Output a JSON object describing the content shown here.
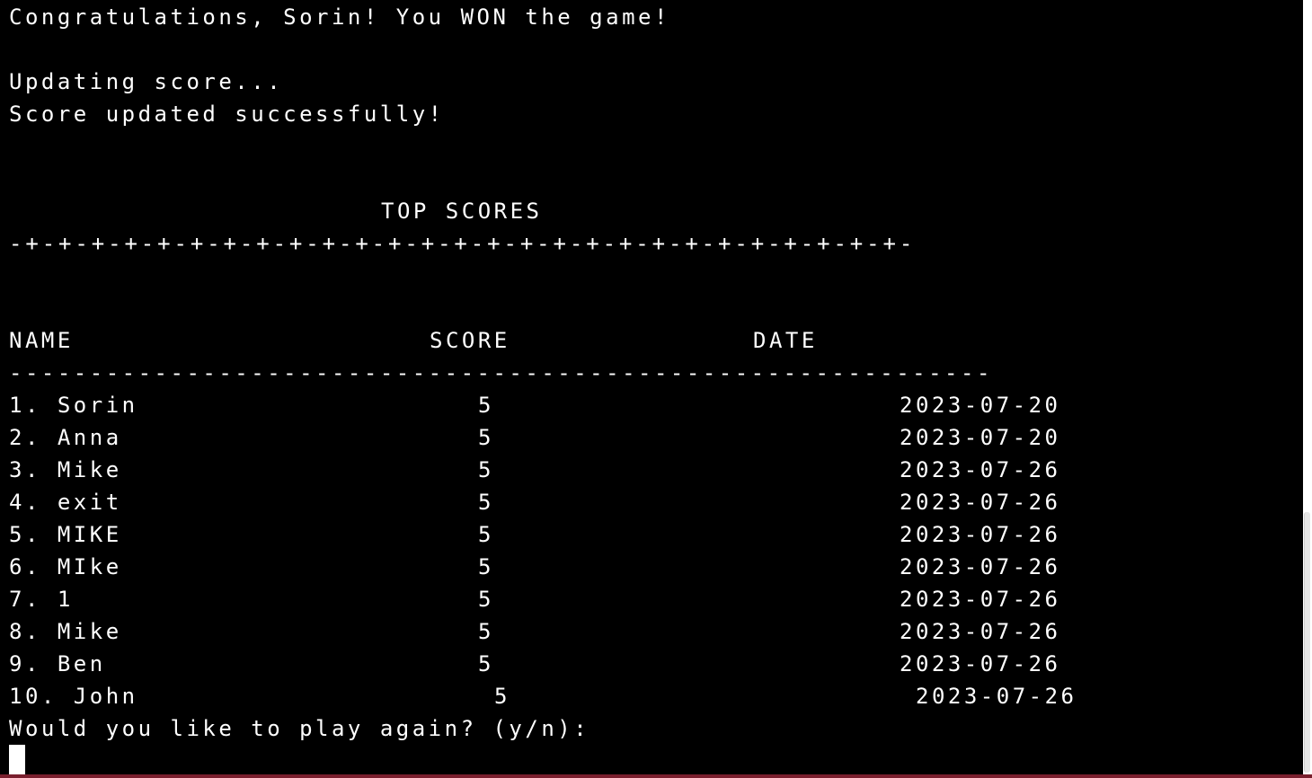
{
  "messages": {
    "congrats": "Congratulations, Sorin! You WON the game!",
    "updating": "Updating score...",
    "updated": "Score updated successfully!"
  },
  "scoreboard": {
    "title": "TOP SCORES",
    "separator": "-+-+-+-+-+-+-+-+-+-+-+-+-+-+-+-+-+-+-+-+-+-+-+-+-+-+-+-",
    "headers": {
      "name": "NAME",
      "score": "SCORE",
      "date": "DATE"
    },
    "header_rule": "-------------------------------------------------------------",
    "rows": [
      {
        "name": "1. Sorin",
        "score": "5",
        "date": "2023-07-20"
      },
      {
        "name": "2. Anna",
        "score": "5",
        "date": "2023-07-20"
      },
      {
        "name": "3. Mike",
        "score": "5",
        "date": "2023-07-26"
      },
      {
        "name": "4. exit",
        "score": "5",
        "date": "2023-07-26"
      },
      {
        "name": "5. MIKE",
        "score": "5",
        "date": "2023-07-26"
      },
      {
        "name": "6. MIke",
        "score": "5",
        "date": "2023-07-26"
      },
      {
        "name": "7. 1",
        "score": "5",
        "date": "2023-07-26"
      },
      {
        "name": "8. Mike",
        "score": "5",
        "date": "2023-07-26"
      },
      {
        "name": "9. Ben",
        "score": "5",
        "date": "2023-07-26"
      },
      {
        "name": "10. John",
        "score": "5",
        "date": "2023-07-26"
      }
    ]
  },
  "prompt": {
    "text": "Would you like to play again? (y/n):"
  },
  "colors": {
    "background": "#000000",
    "text": "#ffffff",
    "cursor": "#ffffff"
  }
}
